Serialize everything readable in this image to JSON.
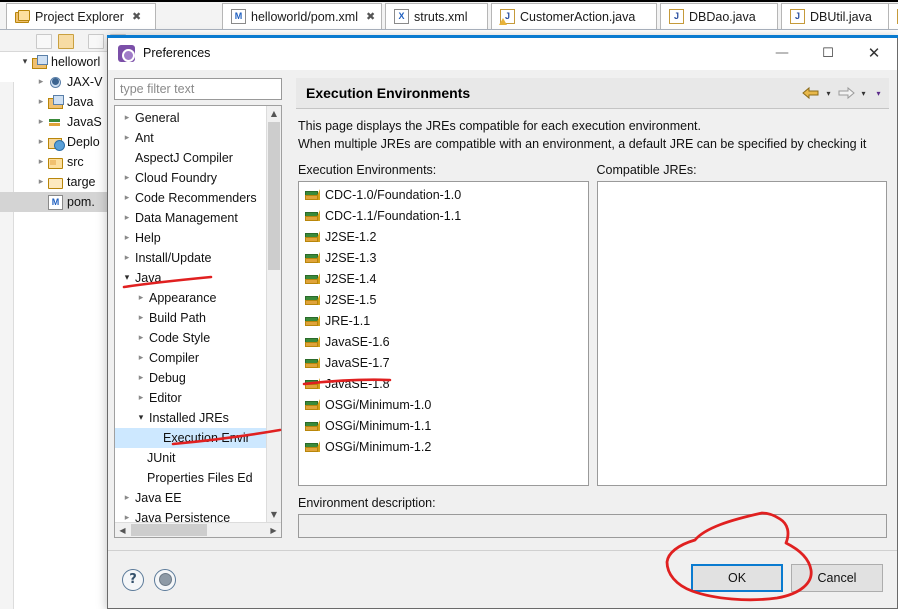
{
  "editor_tabs": [
    {
      "label": "Project Explorer",
      "icon": "project-explorer-icon",
      "closable": true
    },
    {
      "label": "helloworld/pom.xml",
      "icon": "maven-pom-icon",
      "closable": true
    },
    {
      "label": "struts.xml",
      "icon": "xml-file-icon",
      "closable": true
    },
    {
      "label": "CustomerAction.java",
      "icon": "java-file-warning-icon",
      "closable": false
    },
    {
      "label": "DBDao.java",
      "icon": "java-file-icon",
      "closable": false
    },
    {
      "label": "DBUtil.java",
      "icon": "java-file-icon",
      "closable": false
    }
  ],
  "project_explorer": {
    "items": [
      {
        "label": "helloworl",
        "icon": "maven-project-icon",
        "indent": 0,
        "expander": "open"
      },
      {
        "label": "JAX-V",
        "icon": "jaxws-icon",
        "indent": 1,
        "expander": "closed"
      },
      {
        "label": "Java",
        "icon": "java-package-icon",
        "indent": 1,
        "expander": "closed"
      },
      {
        "label": "JavaS",
        "icon": "library-icon",
        "indent": 1,
        "expander": "closed"
      },
      {
        "label": "Deplo",
        "icon": "deployment-descriptor-icon",
        "indent": 1,
        "expander": "closed"
      },
      {
        "label": "src",
        "icon": "source-folder-icon",
        "indent": 1,
        "expander": "closed"
      },
      {
        "label": "targe",
        "icon": "folder-icon",
        "indent": 1,
        "expander": "closed"
      },
      {
        "label": "pom.",
        "icon": "maven-pom-icon",
        "indent": 1,
        "expander": "none",
        "selected": true
      }
    ]
  },
  "dialog": {
    "title": "Preferences",
    "window_controls": {
      "minimize": "—",
      "maximize": "☐",
      "close": "✕"
    },
    "filter": {
      "placeholder": "type filter text",
      "value": ""
    },
    "tree": [
      {
        "label": "General",
        "indent": 0,
        "expander": "closed"
      },
      {
        "label": "Ant",
        "indent": 0,
        "expander": "closed"
      },
      {
        "label": "AspectJ Compiler",
        "indent": 0,
        "expander": "none"
      },
      {
        "label": "Cloud Foundry",
        "indent": 0,
        "expander": "closed"
      },
      {
        "label": "Code Recommenders",
        "indent": 0,
        "expander": "closed"
      },
      {
        "label": "Data Management",
        "indent": 0,
        "expander": "closed"
      },
      {
        "label": "Help",
        "indent": 0,
        "expander": "closed"
      },
      {
        "label": "Install/Update",
        "indent": 0,
        "expander": "closed"
      },
      {
        "label": "Java",
        "indent": 0,
        "expander": "open"
      },
      {
        "label": "Appearance",
        "indent": 1,
        "expander": "closed"
      },
      {
        "label": "Build Path",
        "indent": 1,
        "expander": "closed"
      },
      {
        "label": "Code Style",
        "indent": 1,
        "expander": "closed"
      },
      {
        "label": "Compiler",
        "indent": 1,
        "expander": "closed"
      },
      {
        "label": "Debug",
        "indent": 1,
        "expander": "closed"
      },
      {
        "label": "Editor",
        "indent": 1,
        "expander": "closed"
      },
      {
        "label": "Installed JREs",
        "indent": 1,
        "expander": "open"
      },
      {
        "label": "Execution Envir",
        "indent": 2,
        "expander": "none",
        "selected": true
      },
      {
        "label": "JUnit",
        "indent": 2,
        "expander": "none"
      },
      {
        "label": "Properties Files Ed",
        "indent": 2,
        "expander": "none"
      },
      {
        "label": "Java EE",
        "indent": 0,
        "expander": "closed"
      },
      {
        "label": "Java Persistence",
        "indent": 0,
        "expander": "closed"
      }
    ],
    "page": {
      "title": "Execution Environments",
      "description_line1": "This page displays the JREs compatible for each execution environment.",
      "description_line2": "When multiple JREs are compatible with an environment, a default JRE can be specified by checking it",
      "env_list_label": "Execution Environments:",
      "compatible_label": "Compatible JREs:",
      "environments": [
        "CDC-1.0/Foundation-1.0",
        "CDC-1.1/Foundation-1.1",
        "J2SE-1.2",
        "J2SE-1.3",
        "J2SE-1.4",
        "J2SE-1.5",
        "JRE-1.1",
        "JavaSE-1.6",
        "JavaSE-1.7",
        "JavaSE-1.8",
        "OSGi/Minimum-1.0",
        "OSGi/Minimum-1.1",
        "OSGi/Minimum-1.2"
      ],
      "compatible_jres": [],
      "env_description_label": "Environment description:",
      "env_description_value": ""
    },
    "nav": {
      "back_icon": "back-arrow-icon",
      "back_caret": "▾",
      "forward_icon": "forward-arrow-icon",
      "forward_caret": "▾",
      "menu_caret": "▾"
    },
    "footer": {
      "help_icon": "help-icon",
      "restore_icon": "restore-defaults-icon",
      "ok_label": "OK",
      "cancel_label": "Cancel"
    }
  },
  "annotations": {
    "color": "#e02020",
    "marks": [
      {
        "name": "underline-java-tree-item",
        "type": "underline"
      },
      {
        "name": "underline-execution-environments-tree-item",
        "type": "underline"
      },
      {
        "name": "underline-javase-18-list-item",
        "type": "underline"
      },
      {
        "name": "circle-ok-button",
        "type": "circle"
      }
    ]
  }
}
